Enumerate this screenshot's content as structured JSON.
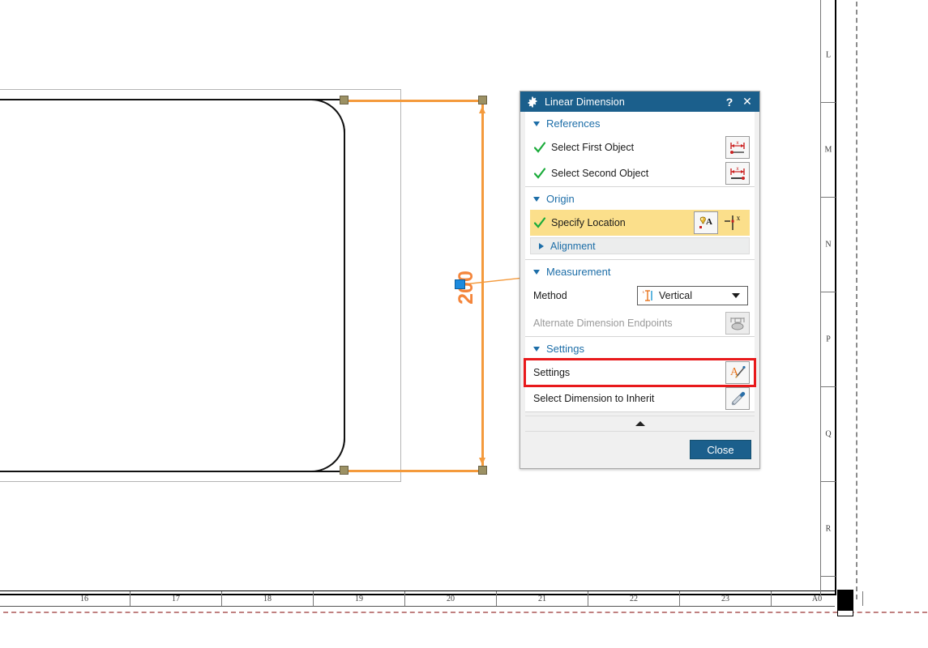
{
  "app": {
    "context": "cad-drafting-sheet"
  },
  "drawing": {
    "dimension_value": "200",
    "dimension_color": "#f4863c",
    "selection_handle_color": "#9c9164",
    "active_handle_color": "#1c8ade",
    "bottom_ruler_labels": [
      "16",
      "17",
      "18",
      "19",
      "20",
      "21",
      "22",
      "23",
      "A0"
    ],
    "right_ruler_labels": [
      "L",
      "M",
      "N",
      "P",
      "Q",
      "R"
    ]
  },
  "dialog": {
    "title": "Linear Dimension",
    "title_icon": "gear-icon",
    "help_label": "?",
    "close_label": "✕",
    "accent_color": "#1b5f8c",
    "highlight_color": "#fbdf8b",
    "callout_color": "#e8191b",
    "sections": {
      "references": {
        "label": "References",
        "rows": [
          {
            "label": "Select First Object",
            "icon": "select-first-object-icon",
            "checked": true
          },
          {
            "label": "Select Second Object",
            "icon": "select-second-object-icon",
            "checked": true
          }
        ]
      },
      "origin": {
        "label": "Origin",
        "specify_location": {
          "label": "Specify Location",
          "checked": true
        },
        "annotation_icon": "annotation-text-icon",
        "point_icon": "point-on-curve-icon",
        "alignment_label": "Alignment"
      },
      "measurement": {
        "label": "Measurement",
        "method_label": "Method",
        "method_value": "Vertical",
        "method_icon": "vertical-measure-icon",
        "alternate_endpoints_label": "Alternate Dimension Endpoints",
        "alternate_endpoints_icon": "alternate-endpoints-icon",
        "alternate_endpoints_enabled": false
      },
      "settings": {
        "label": "Settings",
        "settings_row_label": "Settings",
        "settings_row_icon": "style-brush-icon",
        "inherit_row_label": "Select Dimension to Inherit",
        "inherit_row_icon": "eyedropper-icon"
      }
    },
    "footer": {
      "collapse_icon": "collapse-up-icon",
      "close_button": "Close"
    }
  }
}
